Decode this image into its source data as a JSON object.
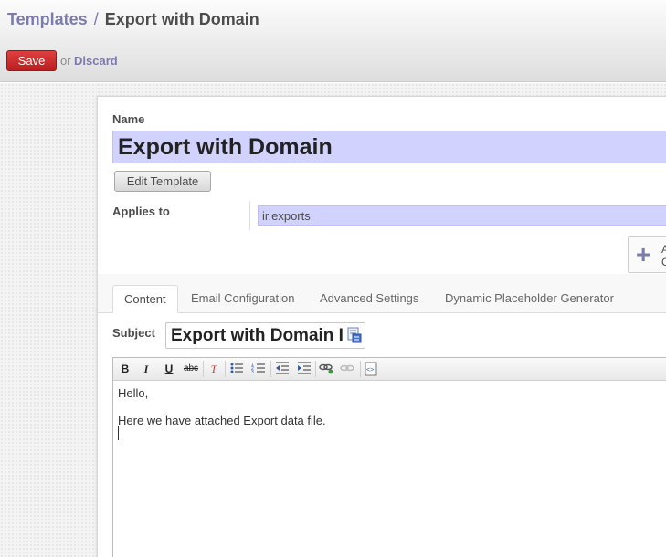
{
  "header": {
    "breadcrumb_parent": "Templates",
    "breadcrumb_separator": "/",
    "breadcrumb_current": "Export with Domain",
    "save_label": "Save",
    "or_text": "or",
    "discard_label": "Discard"
  },
  "form": {
    "name_label": "Name",
    "name_value": "Export with Domain",
    "edit_template_label": "Edit Template",
    "applies_to_label": "Applies to",
    "applies_to_value": "ir.exports",
    "add_button_line1": "A",
    "add_button_line2": "C"
  },
  "tabs": [
    {
      "label": "Content",
      "active": true
    },
    {
      "label": "Email Configuration",
      "active": false
    },
    {
      "label": "Advanced Settings",
      "active": false
    },
    {
      "label": "Dynamic Placeholder Generator",
      "active": false
    }
  ],
  "content": {
    "subject_label": "Subject",
    "subject_value": "Export with Domain I",
    "toolbar": [
      "bold-icon",
      "italic-icon",
      "underline-icon",
      "strikethrough-icon",
      "remove-format-icon",
      "bullet-list-icon",
      "numbered-list-icon",
      "outdent-icon",
      "indent-icon",
      "link-icon",
      "unlink-icon",
      "source-icon"
    ],
    "body_line1": "Hello,",
    "body_line2": "Here we have attached Export data file."
  },
  "colors": {
    "accent": "#7c7bad",
    "save_button": "#c52828",
    "input_highlight": "#d2d2ff"
  }
}
